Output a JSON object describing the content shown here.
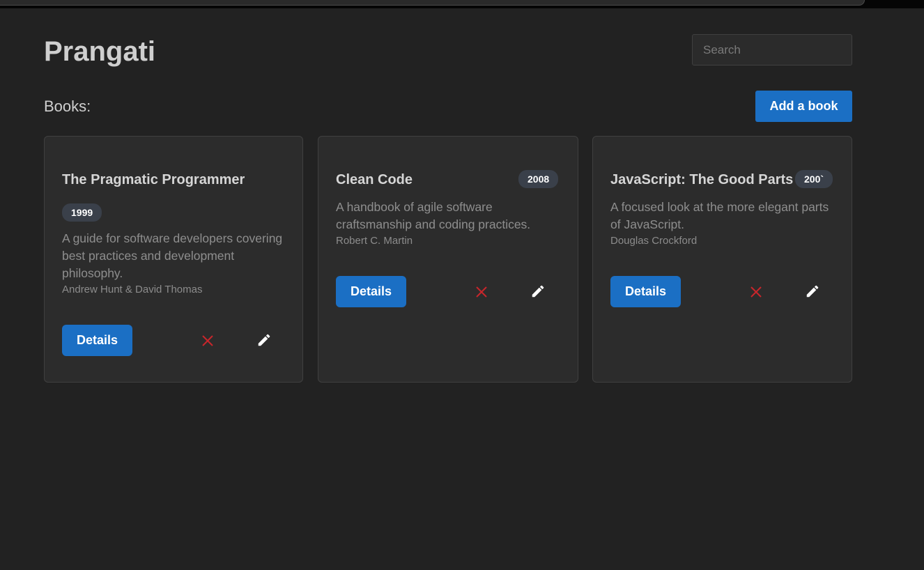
{
  "app": {
    "title": "Prangati"
  },
  "search": {
    "placeholder": "Search",
    "value": ""
  },
  "books_section": {
    "label": "Books:",
    "add_button_label": "Add a book"
  },
  "books": [
    {
      "title": "The Pragmatic Programmer",
      "year": "1999",
      "description": "A guide for software developers covering best practices and development philosophy.",
      "author": "Andrew Hunt & David Thomas",
      "details_label": "Details"
    },
    {
      "title": "Clean Code",
      "year": "2008",
      "description": "A handbook of agile software craftsmanship and coding practices.",
      "author": "Robert C. Martin",
      "details_label": "Details"
    },
    {
      "title": "JavaScript: The Good Parts",
      "year": "200`",
      "description": "A focused look at the more elegant parts of JavaScript.",
      "author": "Douglas Crockford",
      "details_label": "Details"
    }
  ],
  "icons": {
    "delete": "close-icon",
    "edit": "pencil-icon"
  },
  "colors": {
    "background": "#222222",
    "card": "#2c2c2c",
    "primary": "#1b6fc4",
    "delete": "#c8262b",
    "badge": "#3a404a"
  }
}
